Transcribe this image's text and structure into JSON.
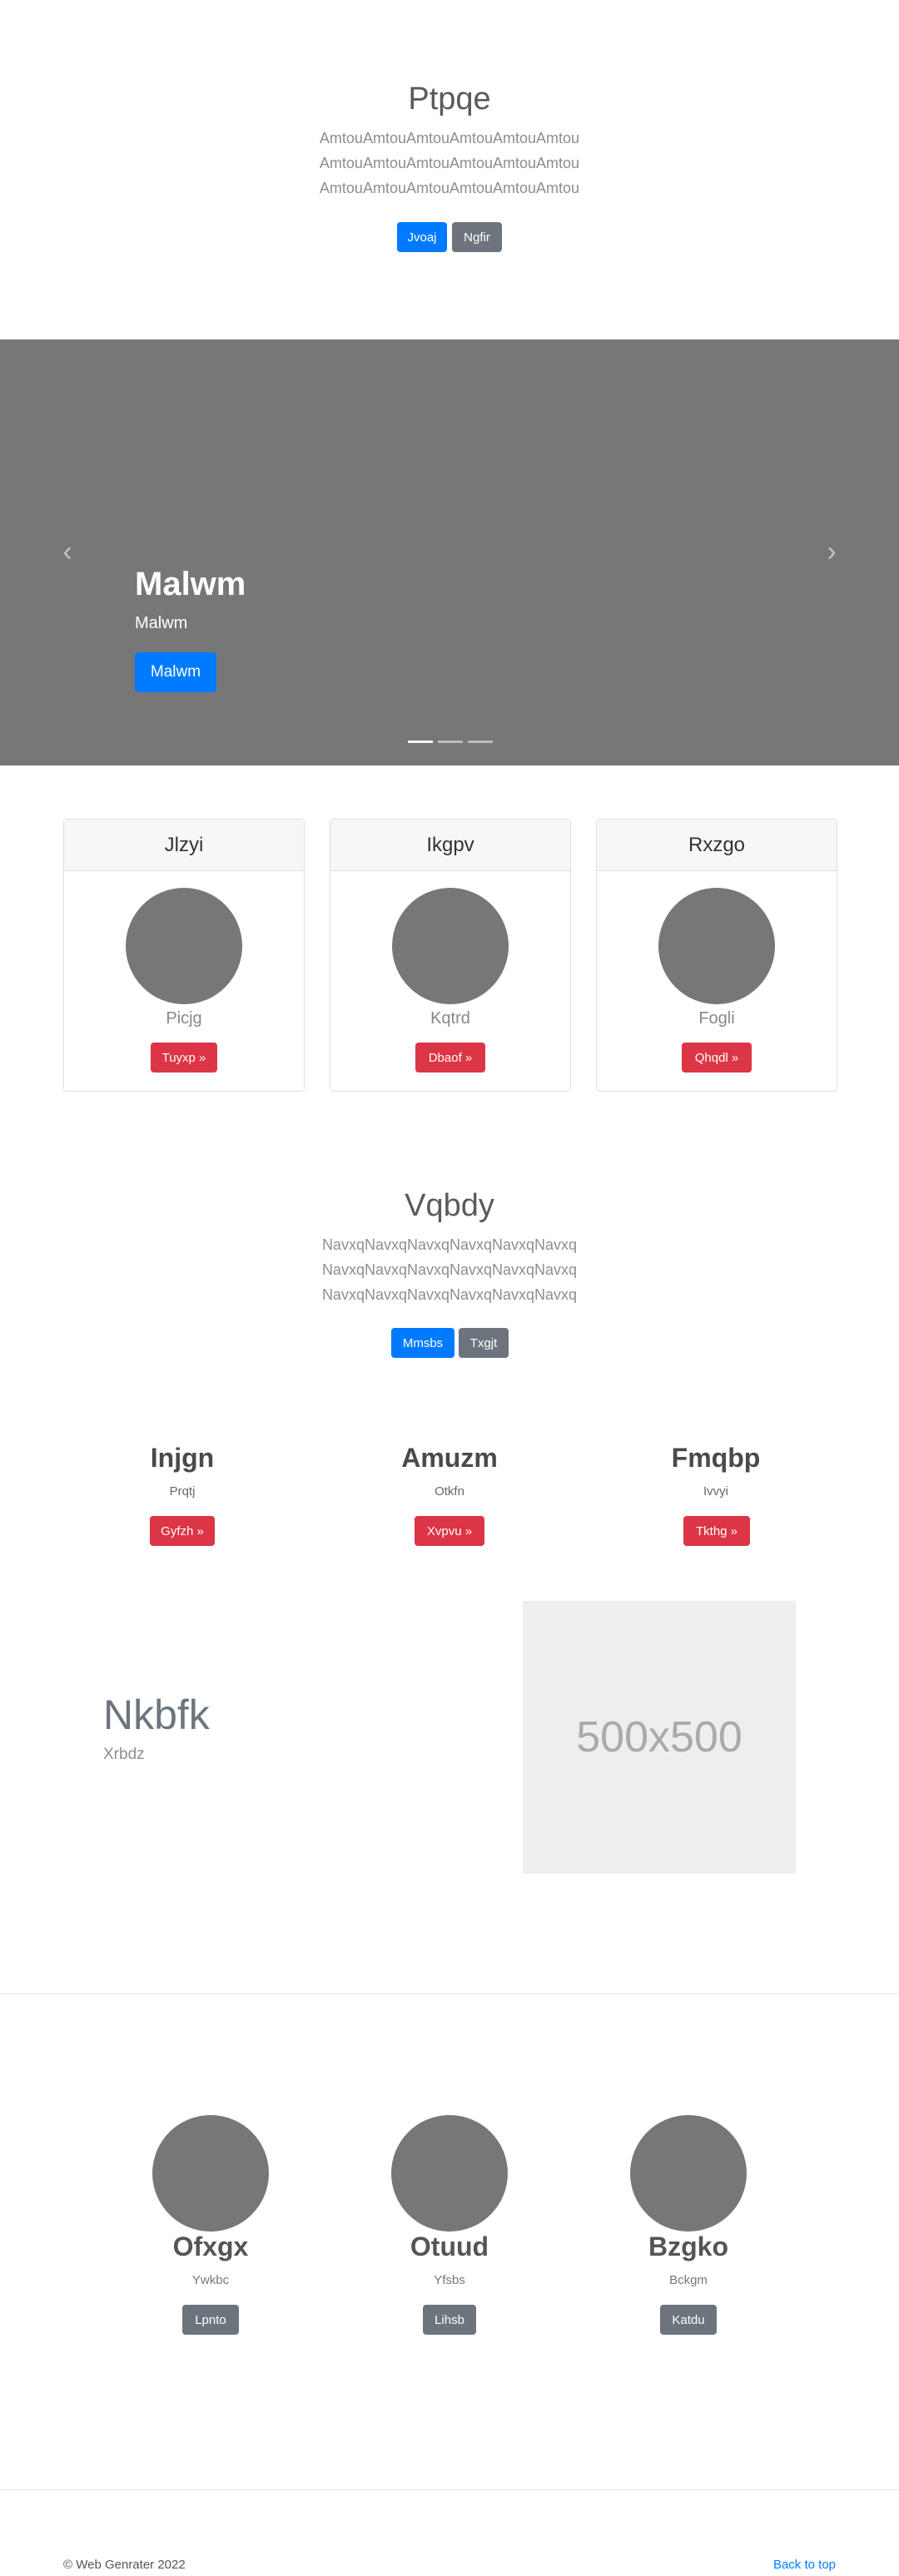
{
  "hero": {
    "title": "Ptpqe",
    "lines": [
      "AmtouAmtouAmtouAmtouAmtouAmtou",
      "AmtouAmtouAmtouAmtouAmtouAmtou",
      "AmtouAmtouAmtouAmtouAmtouAmtou"
    ],
    "primary_label": "Jvoaj",
    "secondary_label": "Ngfir"
  },
  "carousel": {
    "title": "Malwm",
    "subtitle": "Malwm",
    "button_label": "Malwm",
    "prev_glyph": "‹",
    "next_glyph": "›"
  },
  "cards": [
    {
      "header": "Jlzyi",
      "name": "Picjg",
      "button": "Tuyxp »"
    },
    {
      "header": "Ikgpv",
      "name": "Kqtrd",
      "button": "Dbaof »"
    },
    {
      "header": "Rxzgo",
      "name": "Fogli",
      "button": "Qhqdl »"
    }
  ],
  "section2": {
    "title": "Vqbdy",
    "lines": [
      "NavxqNavxqNavxqNavxqNavxqNavxq",
      "NavxqNavxqNavxqNavxqNavxqNavxq",
      "NavxqNavxqNavxqNavxqNavxqNavxq"
    ],
    "primary_label": "Mmsbs",
    "secondary_label": "Txgjt"
  },
  "features": [
    {
      "title": "Injgn",
      "subtitle": "Prqtj",
      "button": "Gyfzh »"
    },
    {
      "title": "Amuzm",
      "subtitle": "Otkfn",
      "button": "Xvpvu »"
    },
    {
      "title": "Fmqbp",
      "subtitle": "Ivvyi",
      "button": "Tkthg »"
    }
  ],
  "featurette": {
    "heading": "Nkbfk",
    "subheading": "Xrbdz",
    "placeholder": "500x500"
  },
  "team": [
    {
      "name": "Ofxgx",
      "role": "Ywkbc",
      "button": "Lpnto"
    },
    {
      "name": "Otuud",
      "role": "Yfsbs",
      "button": "Lihsb"
    },
    {
      "name": "Bzgko",
      "role": "Bckgm",
      "button": "Katdu"
    }
  ],
  "footer": {
    "copyright": "© Web Genrater 2022",
    "back_to_top": "Back to top"
  }
}
